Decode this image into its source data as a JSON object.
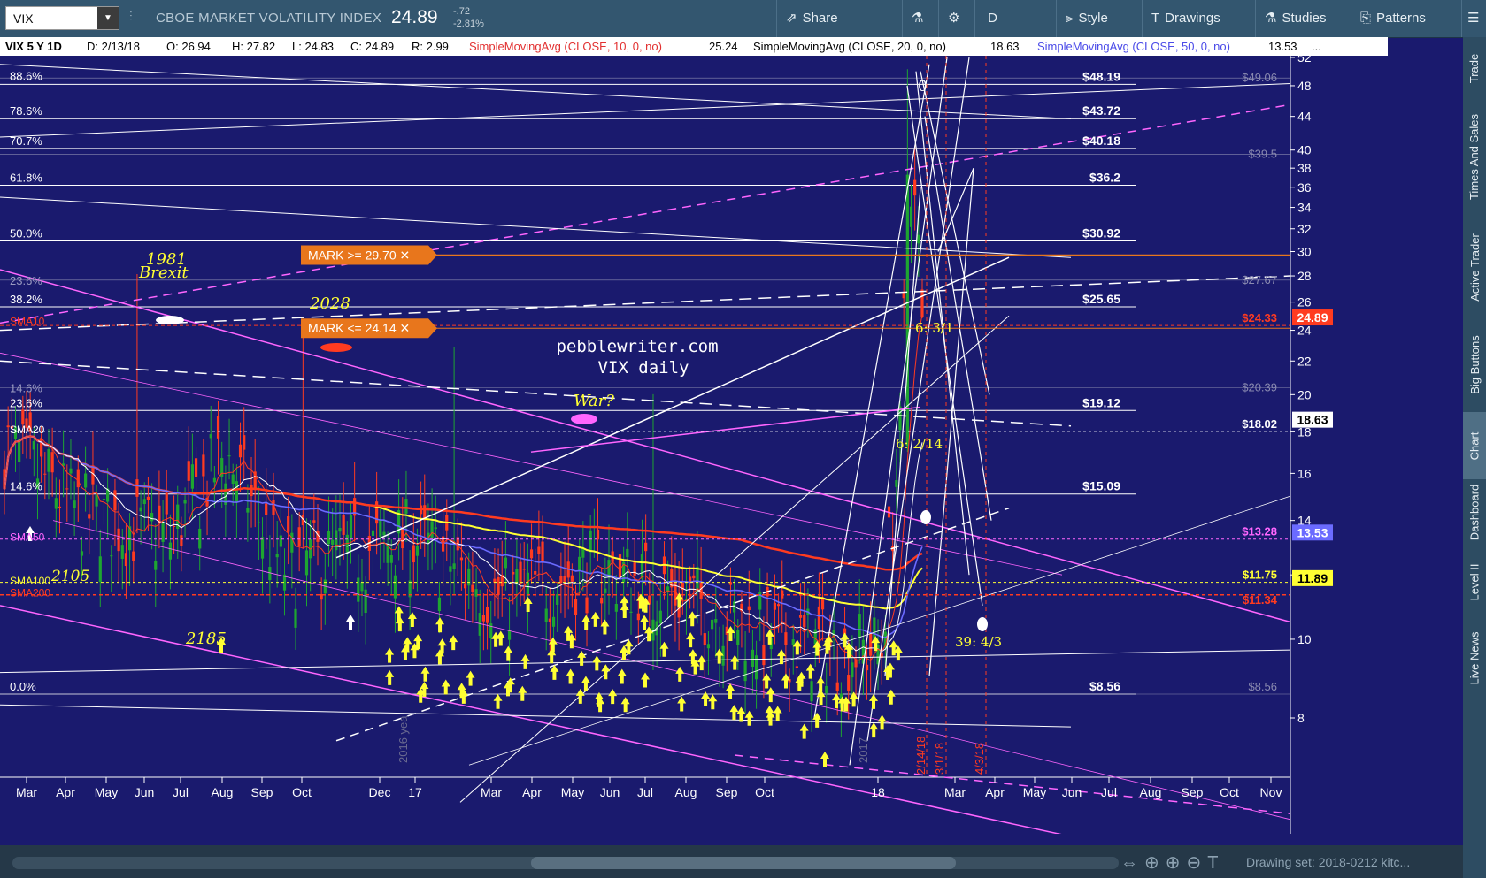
{
  "toolbar": {
    "symbol": "VIX",
    "description": "CBOE MARKET VOLATILITY INDEX",
    "last": "24.89",
    "change": "-.72",
    "change_pct": "-2.81%",
    "share": "Share",
    "period": "D",
    "style": "Style",
    "drawings": "Drawings",
    "studies": "Studies",
    "patterns": "Patterns"
  },
  "infobar": {
    "series": "VIX 5 Y 1D",
    "date": "D: 2/13/18",
    "open": "O: 26.94",
    "high": "H: 27.82",
    "low": "L: 24.83",
    "close": "C: 24.89",
    "range": "R: 2.99",
    "sma10_label": "SimpleMovingAvg (CLOSE, 10, 0, no)",
    "sma10_value": "25.24",
    "sma20_label": "SimpleMovingAvg (CLOSE, 20, 0, no)",
    "sma20_value": "18.63",
    "sma50_label": "SimpleMovingAvg (CLOSE, 50, 0, no)",
    "sma50_value": "13.53",
    "more": "..."
  },
  "sidebar": [
    "Trade",
    "Times And Sales",
    "Active Trader",
    "Big Buttons",
    "Chart",
    "Dashboard",
    "Level II",
    "Live News"
  ],
  "sidebar_active": "Chart",
  "bottombar": {
    "drawing_set": "Drawing set: 2018-0212 kitc..."
  },
  "chart": {
    "title": "pebblewriter.com",
    "subtitle": "VIX daily",
    "y_ticks": [
      52,
      48,
      44,
      40,
      38,
      36,
      34,
      32,
      30,
      28,
      26,
      24,
      22,
      20,
      18,
      16,
      14,
      12,
      10,
      8
    ],
    "x_ticks": [
      "Mar",
      "Apr",
      "May",
      "Jun",
      "Jul",
      "Aug",
      "Sep",
      "Oct",
      "Dec",
      "17",
      "Mar",
      "Apr",
      "May",
      "Jun",
      "Jul",
      "Aug",
      "Sep",
      "Oct",
      "18",
      "Mar",
      "Apr",
      "May",
      "Jun",
      "Jul",
      "Aug",
      "Sep",
      "Oct",
      "Nov"
    ],
    "fib_left": [
      {
        "label": "88.6%",
        "value": 48.3
      },
      {
        "label": "78.6%",
        "value": 43.72
      },
      {
        "label": "70.7%",
        "value": 40.18
      },
      {
        "label": "61.8%",
        "value": 36.2
      },
      {
        "label": "50.0%",
        "value": 30.92
      },
      {
        "label": "38.2%",
        "value": 25.65
      },
      {
        "label": "23.6%",
        "value": 19.12
      },
      {
        "label": "14.6%",
        "value": 15.09
      },
      {
        "label": "0.0%",
        "value": 8.56
      }
    ],
    "fib_left_gray": [
      {
        "label": "23.6%",
        "value": 27.67
      },
      {
        "label": "14.6%",
        "value": 20.39
      }
    ],
    "fib_right": [
      {
        "label": "$48.19",
        "value": 48.19
      },
      {
        "label": "$43.72",
        "value": 43.72
      },
      {
        "label": "$40.18",
        "value": 40.18
      },
      {
        "label": "$36.2",
        "value": 36.2
      },
      {
        "label": "$30.92",
        "value": 30.92
      },
      {
        "label": "$25.65",
        "value": 25.65
      },
      {
        "label": "$19.12",
        "value": 19.12
      },
      {
        "label": "$15.09",
        "value": 15.09
      },
      {
        "label": "$8.56",
        "value": 8.56
      }
    ],
    "gray_right": [
      {
        "label": "$49.06",
        "value": 49.06
      },
      {
        "label": "$39.5",
        "value": 39.5
      },
      {
        "label": "$27.67",
        "value": 27.67
      },
      {
        "label": "$20.39",
        "value": 20.39
      },
      {
        "label": "$8.56",
        "value": 8.56
      }
    ],
    "ma_right": [
      {
        "label": "$24.33",
        "value": 24.33,
        "color": "#ff3b20"
      },
      {
        "label": "$18.02",
        "value": 18.02,
        "color": "#ffffff"
      },
      {
        "label": "$13.28",
        "value": 13.28,
        "color": "#ff66ff"
      },
      {
        "label": "$11.75",
        "value": 11.75,
        "color": "#ffff33"
      },
      {
        "label": "$11.34",
        "value": 11.34,
        "color": "#ff3b20"
      }
    ],
    "price_tags": [
      {
        "label": "24.89",
        "value": 24.89,
        "bg": "#ff3b20",
        "fg": "#ffffff"
      },
      {
        "label": "18.63",
        "value": 18.63,
        "bg": "#ffffff",
        "fg": "#000000"
      },
      {
        "label": "13.53",
        "value": 13.53,
        "bg": "#6b6bff",
        "fg": "#ffffff"
      },
      {
        "label": "11.89",
        "value": 11.89,
        "bg": "#ffff33",
        "fg": "#000000"
      }
    ],
    "ma_left": [
      {
        "label": "SMA10",
        "value": 24.6,
        "color": "#ff3b20"
      },
      {
        "label": "SMA20",
        "value": 18.1,
        "color": "#ffffff"
      },
      {
        "label": "SMA50",
        "value": 13.35,
        "color": "#ff66ff"
      },
      {
        "label": "SMA100",
        "value": 11.8,
        "color": "#ffff33"
      },
      {
        "label": "SMA200",
        "value": 11.4,
        "color": "#ff3b20"
      }
    ],
    "marks": [
      {
        "label": "MARK >= 29.70",
        "value": 29.7
      },
      {
        "label": "MARK <= 24.14",
        "value": 24.14
      }
    ],
    "annotations": [
      "1981",
      "Brexit",
      "2028",
      "War?",
      "2185",
      "2105",
      "6: 3/1",
      "6: 2/14",
      "39: 4/3",
      "0",
      "2016 yea",
      "2017"
    ],
    "vertical_dates": [
      "2/14/18",
      "3/1/18",
      "4/3/18"
    ],
    "colors": {
      "background": "#1a1a6e",
      "candle_up": "#1ea531",
      "candle_down": "#ff3b20",
      "sma10": "#ff3b20",
      "sma20": "#ffffff",
      "sma50": "#6b6bff",
      "sma200": "#ff3b20",
      "sma100": "#ffff33",
      "magenta": "#ff66ff",
      "mark": "#e8761c",
      "yellow_arrows": "#ffff33"
    }
  }
}
